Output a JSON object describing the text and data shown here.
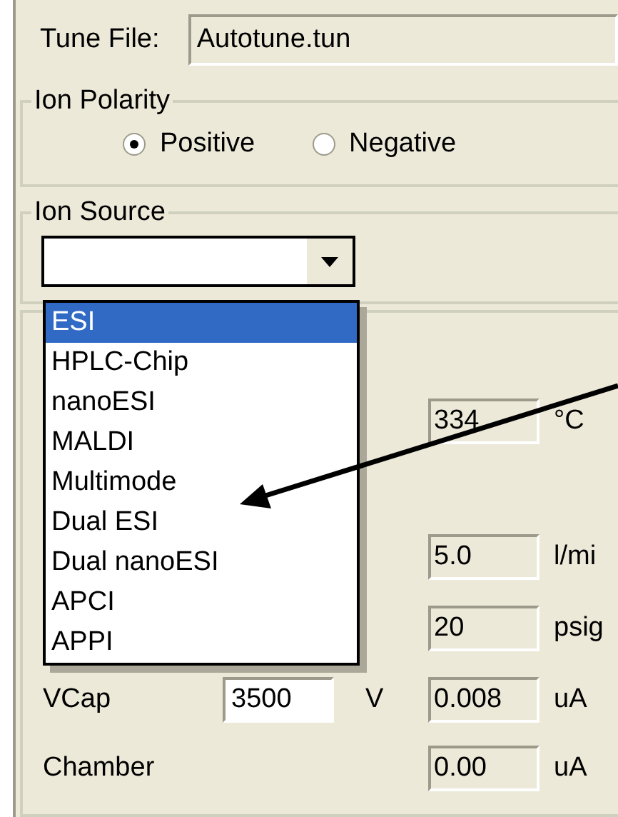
{
  "tune_file": {
    "label": "Tune File:",
    "value": "Autotune.tun"
  },
  "ion_polarity": {
    "title": "Ion Polarity",
    "options": [
      {
        "label": "Positive",
        "selected": true
      },
      {
        "label": "Negative",
        "selected": false
      }
    ]
  },
  "ion_source": {
    "title": "Ion Source",
    "expanded": true,
    "options": [
      {
        "label": "ESI",
        "selected": true
      },
      {
        "label": "HPLC-Chip",
        "selected": false
      },
      {
        "label": "nanoESI",
        "selected": false
      },
      {
        "label": "MALDI",
        "selected": false
      },
      {
        "label": "Multimode",
        "selected": false
      },
      {
        "label": "Dual ESI",
        "selected": false
      },
      {
        "label": "Dual nanoESI",
        "selected": false
      },
      {
        "label": "APCI",
        "selected": false
      },
      {
        "label": "APPI",
        "selected": false
      }
    ]
  },
  "readings": [
    {
      "reading": "334",
      "unit": "°C"
    },
    {
      "reading": "5.0",
      "unit": "l/mi"
    },
    {
      "reading": "20",
      "unit": "psig"
    },
    {
      "label": "VCap",
      "setpoint": "3500",
      "setpoint_unit": "V",
      "reading": "0.008",
      "unit": "uA"
    },
    {
      "label": "Chamber",
      "reading": "0.00",
      "unit": "uA"
    }
  ]
}
